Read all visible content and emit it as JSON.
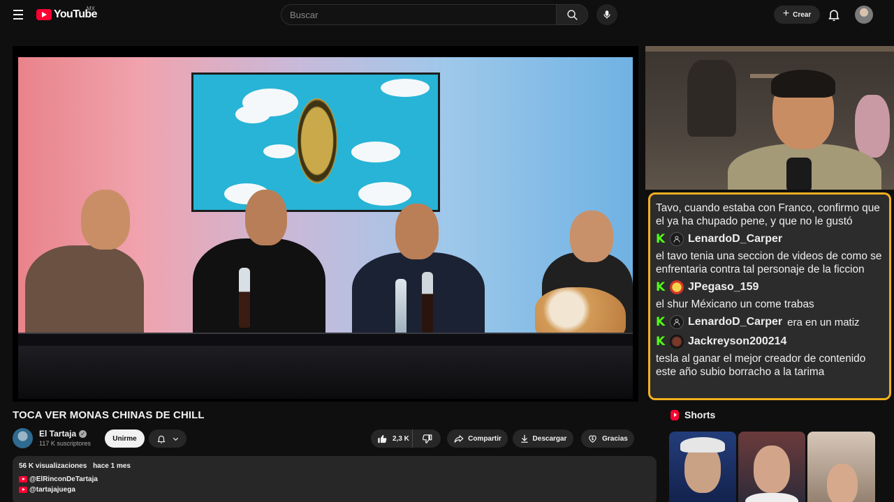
{
  "header": {
    "logo_text": "YouTube",
    "country_code": "MX",
    "search_placeholder": "Buscar",
    "create_label": "Crear"
  },
  "video": {
    "title": "TOCA VER MONAS CHINAS DE CHILL"
  },
  "channel": {
    "name": "El Tartaja",
    "subscribers": "117 K suscriptores",
    "join_label": "Unirme"
  },
  "actions": {
    "likes": "2,3 K",
    "share_label": "Compartir",
    "download_label": "Descargar",
    "thanks_label": "Gracias"
  },
  "description": {
    "views": "56 K visualizaciones",
    "date": "hace 1 mes",
    "links": [
      "@ElRinconDeTartaja",
      "@tartajajuega"
    ]
  },
  "chat": {
    "first_message": "Tavo, cuando estaba con Franco, confirmo que el ya ha chupado pene, y que no le gustó",
    "messages": [
      {
        "user": "LenardoD_Carper",
        "text": "el tavo tenia una seccion de videos de como se enfrentaria contra tal personaje de la ficcion"
      },
      {
        "user": "JPegaso_159",
        "text": "el shur Méxicano un come trabas"
      },
      {
        "user": "LenardoD_Carper",
        "text": "era en un matiz"
      },
      {
        "user": "Jackreyson200214",
        "text": "tesla al ganar el mejor creador de contenido este año subio borracho a la tarima"
      }
    ]
  },
  "shorts": {
    "title": "Shorts"
  },
  "colors": {
    "background": "#0f0f0f",
    "brand_red": "#ff0033",
    "chat_border": "#f2b01e",
    "kick_green": "#53fc18",
    "pill": "#272727"
  },
  "icons": [
    "menu-icon",
    "youtube-logo-icon",
    "search-icon",
    "mic-icon",
    "plus-icon",
    "bell-icon",
    "verified-icon",
    "like-icon",
    "dislike-icon",
    "share-icon",
    "download-icon",
    "thanks-icon",
    "shorts-icon",
    "kick-badge-icon"
  ]
}
